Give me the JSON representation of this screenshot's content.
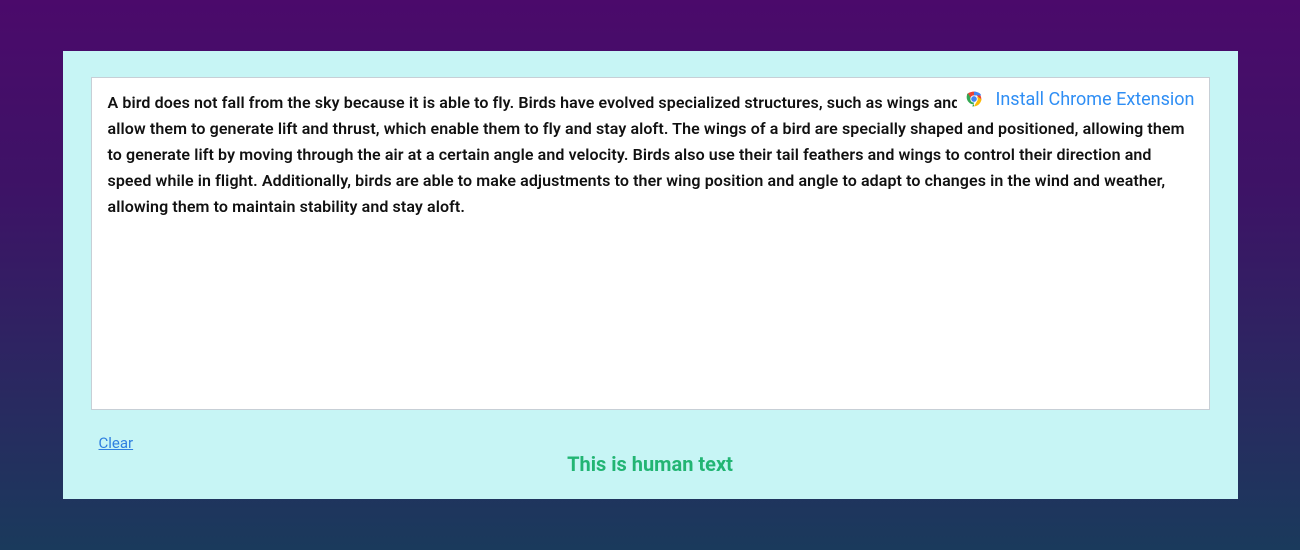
{
  "textbox": {
    "content": "A bird does not fall from the sky because it is able to fly. Birds have evolved specialized structures, such as wings and strong breast muscle, that allow them to generate lift and thrust, which enable them to fly and stay aloft. The wings of a bird are specially shaped and positioned, allowing them to generate lift by moving through the air at a certain angle and velocity. Birds also use their tail feathers and wings to control their direction and speed while in flight. Additionally, birds are able to make adjustments to ther wing position and angle to adapt to changes in the wind and weather, allowing them to maintain stability and stay aloft."
  },
  "extension_cta": {
    "label": "Install Chrome Extension"
  },
  "actions": {
    "clear_label": "Clear"
  },
  "result": {
    "label": "This is human text"
  }
}
